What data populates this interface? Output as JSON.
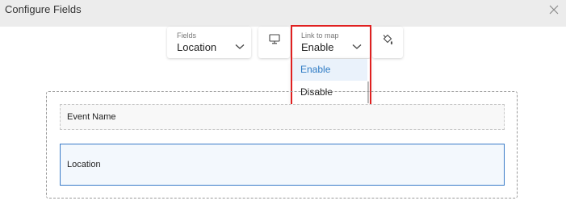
{
  "dialog": {
    "title": "Configure Fields"
  },
  "toolbar": {
    "fields": {
      "label": "Fields",
      "value": "Location"
    },
    "display_icon": "monitor-icon",
    "link_to_map": {
      "label": "Link to map",
      "value": "Enable",
      "options": [
        "Enable",
        "Disable"
      ],
      "highlighted_option": "Enable"
    },
    "style_icon": "paint-bucket-icon"
  },
  "canvas": {
    "fields": [
      {
        "name": "Event Name"
      },
      {
        "name": "Location"
      }
    ]
  },
  "colors": {
    "accent": "#2e7bc4",
    "highlight_border": "#e02020",
    "selected_field_border": "#3a7bc8"
  }
}
